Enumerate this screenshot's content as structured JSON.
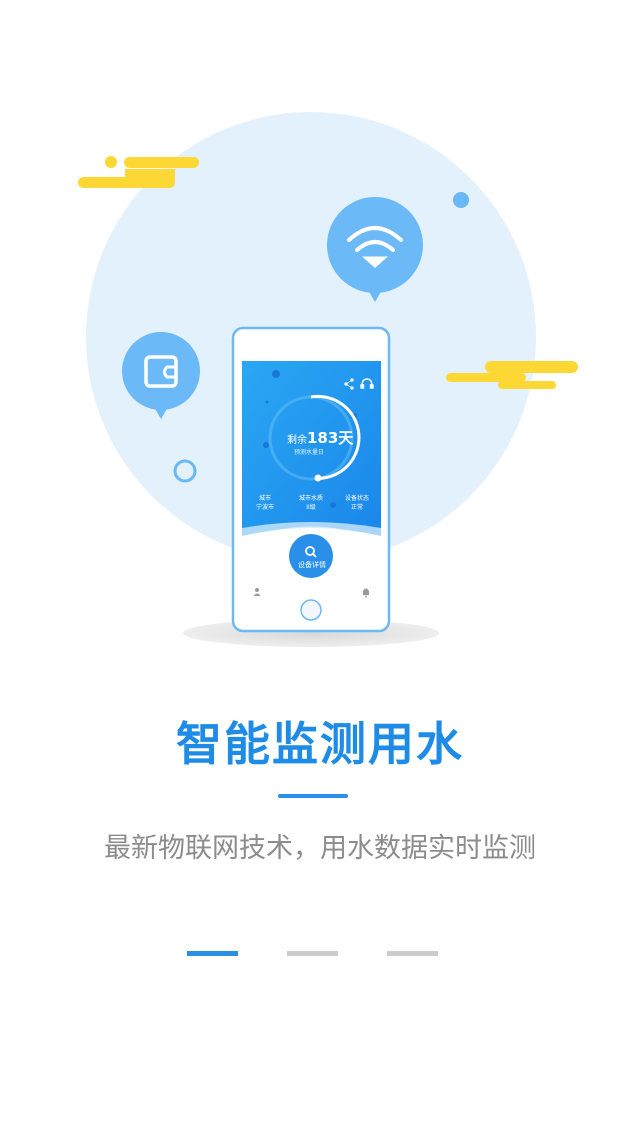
{
  "illustration": {
    "phone": {
      "remaining_prefix": "剩余",
      "remaining_value": "183天",
      "sub_label": "预测水量日",
      "stats": [
        {
          "label": "城市",
          "value": "宁波市"
        },
        {
          "label": "城市水质",
          "value": "II级"
        },
        {
          "label": "设备状态",
          "value": "正常"
        }
      ],
      "detail_button_label": "设备详情"
    },
    "icons": [
      "wifi-icon",
      "wallet-icon",
      "search-icon",
      "share-icon",
      "headset-icon",
      "user-icon",
      "bell-icon"
    ]
  },
  "content": {
    "title": "智能监测用水",
    "subtitle": "最新物联网技术，用水数据实时监测"
  },
  "pagination": {
    "total": 3,
    "active": 1
  },
  "colors": {
    "accent": "#2a8fe8",
    "circle_bg": "#e3f1fc",
    "cloud": "#fdd835",
    "inactive_dot": "#cccccc",
    "subtitle": "#8c8c8c"
  }
}
